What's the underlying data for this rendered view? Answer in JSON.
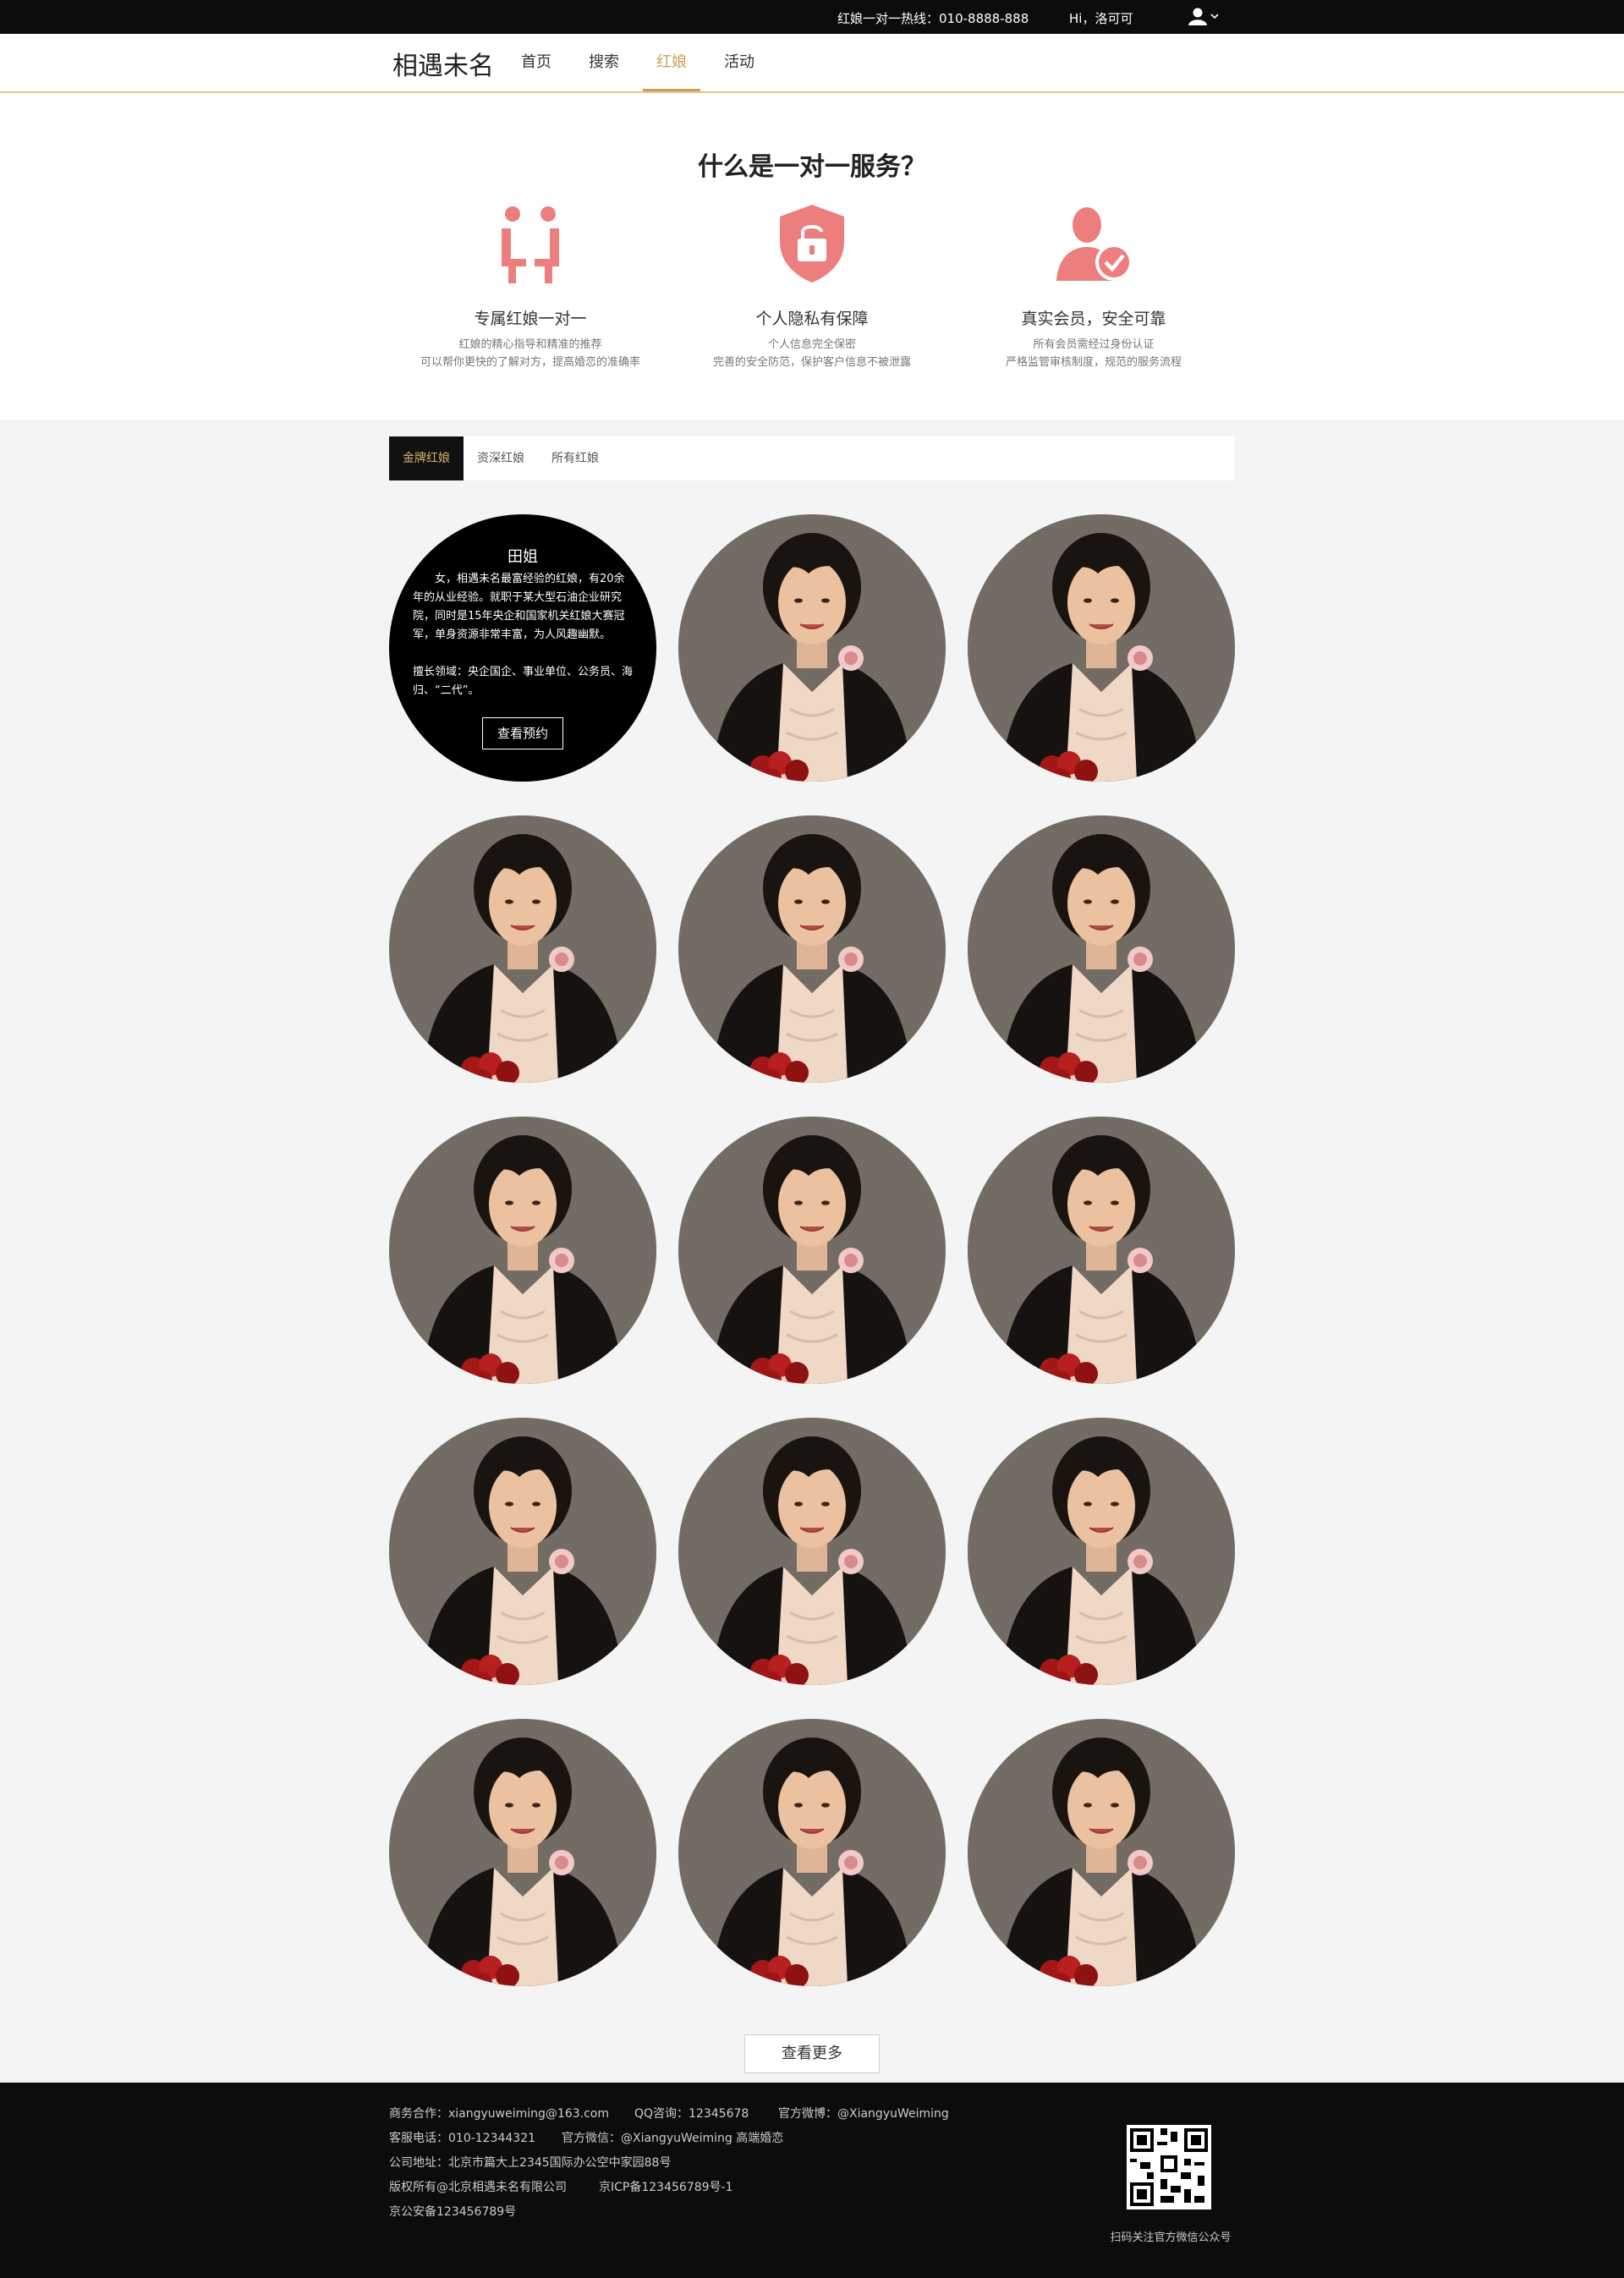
{
  "topbar": {
    "hotline": "红娘一对一热线：010-8888-888",
    "greeting": "Hi，洛可可",
    "user_icon": "user-icon"
  },
  "header": {
    "logo_text": "相遇未名",
    "nav": [
      {
        "label": "首页",
        "active": false
      },
      {
        "label": "搜索",
        "active": false
      },
      {
        "label": "红娘",
        "active": true
      },
      {
        "label": "活动",
        "active": false
      }
    ]
  },
  "service": {
    "title": "什么是一对一服务？",
    "accent_color": "#ec7e7e",
    "features": [
      {
        "icon": "matchmaker-icon",
        "title": "专属红娘一对一",
        "desc1": "红娘的精心指导和精准的推荐",
        "desc2": "可以帮你更快的了解对方，提高婚恋的准确率"
      },
      {
        "icon": "privacy-shield-icon",
        "title": "个人隐私有保障",
        "desc1": "个人信息完全保密",
        "desc2": "完善的安全防范，保护客户信息不被泄露"
      },
      {
        "icon": "verified-user-icon",
        "title": "真实会员，安全可靠",
        "desc1": "所有会员需经过身份认证",
        "desc2": "严格监管审核制度，规范的服务流程"
      }
    ]
  },
  "tabs": [
    {
      "label": "金牌红娘",
      "active": true
    },
    {
      "label": "资深红娘",
      "active": false
    },
    {
      "label": "所有红娘",
      "active": false
    }
  ],
  "matchmaker": {
    "name": "田姐",
    "bio": "女，相遇未名最富经验的红娘，有20余年的从业经验。就职于某大型石油企业研究院，同时是15年央企和国家机关红娘大赛冠军，单身资源非常丰富，为人风趣幽默。",
    "fields": "擅长领域：央企国企、事业单位、公务员、海归、“二代”。",
    "button": "查看预约"
  },
  "load_more": "查看更多",
  "footer": {
    "business": "商务合作：xiangyuweiming@163.com",
    "qq": "QQ咨询：12345678",
    "weibo": "官方微博：@XiangyuWeiming",
    "phone": "客服电话：010-12344321",
    "wechat": "官方微信：@XiangyuWeiming 高端婚恋",
    "address": "公司地址：北京市篇大上2345国际办公空中家园88号",
    "copyright": "版权所有@北京相遇未名有限公司",
    "icp": "京ICP备123456789号-1",
    "police": "京公安备123456789号",
    "qr_caption": "扫码关注官方微信公众号"
  }
}
